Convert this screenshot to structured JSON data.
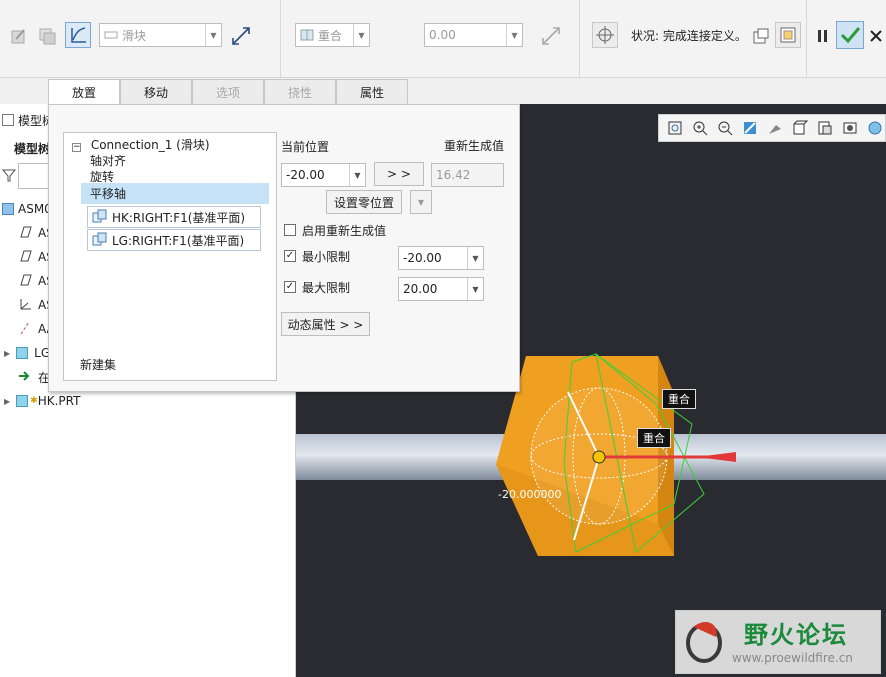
{
  "ribbon": {
    "type_combo": "滑块",
    "constraint_combo": "重合",
    "offset_value": "0.00",
    "status": "状况: 完成连接定义。"
  },
  "tabs": [
    {
      "label": "放置",
      "state": "active"
    },
    {
      "label": "移动",
      "state": "normal"
    },
    {
      "label": "选项",
      "state": "disabled"
    },
    {
      "label": "挠性",
      "state": "disabled"
    },
    {
      "label": "属性",
      "state": "normal"
    }
  ],
  "tree": {
    "title": "模型树",
    "header": "模型树",
    "rows": [
      "ASM0",
      "AS",
      "AS",
      "AS",
      "AS",
      "AA",
      "LG",
      "在",
      "HK.PRT"
    ]
  },
  "panel": {
    "connection": "Connection_1 (滑块)",
    "constraints": [
      "轴对齐",
      "旋转",
      "平移轴"
    ],
    "refs": [
      "HK:RIGHT:F1(基准平面)",
      "LG:RIGHT:F1(基准平面)"
    ],
    "new_set": "新建集",
    "current_pos_label": "当前位置",
    "regen_label": "重新生成值",
    "current_pos_value": "-20.00",
    "arrow_btn": "> >",
    "regen_value": "16.42",
    "set_zero_btn": "设置零位置",
    "enable_regen": "启用重新生成值",
    "min_label": "最小限制",
    "min_value": "-20.00",
    "max_label": "最大限制",
    "max_value": "20.00",
    "dynamic_btn": "动态属性 > >"
  },
  "viewport": {
    "tag1": "重合",
    "tag2": "重合",
    "dim_value": "-20.000000"
  },
  "watermark": {
    "title": "野火论坛",
    "url": "www.proewildfire.cn"
  },
  "colors": {
    "accent": "#2e8bd1",
    "selection": "#c5e2f7",
    "block": "#f5a623",
    "shaft": "#9aa7b8"
  }
}
